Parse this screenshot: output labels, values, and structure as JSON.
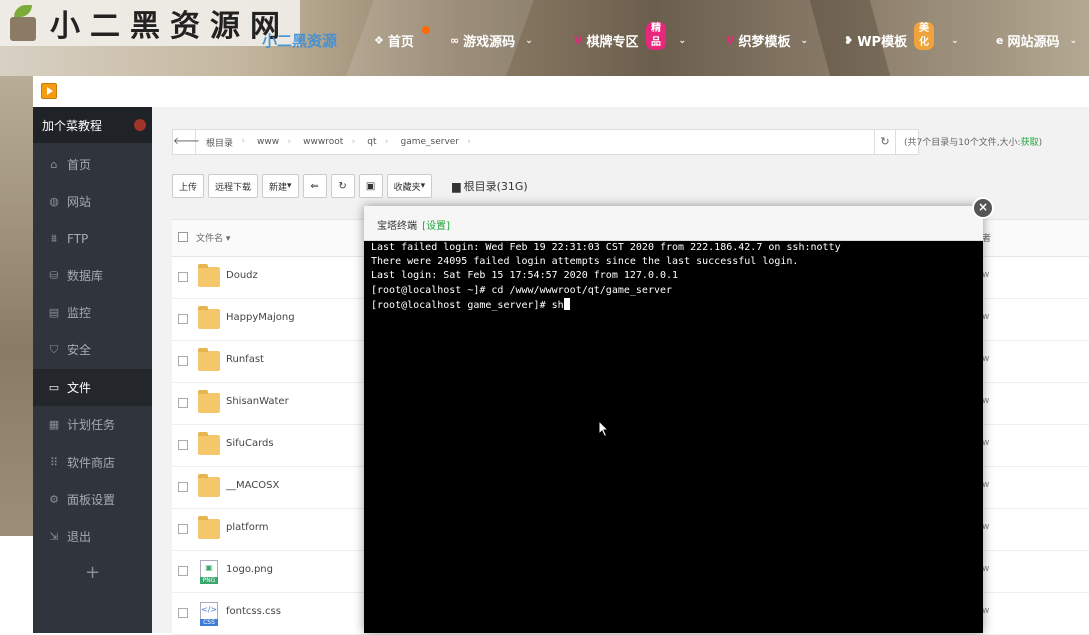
{
  "site": {
    "logo_text": "小二黑资源网",
    "brand_faded": "小二黑资源",
    "nav": [
      {
        "label": "首页",
        "icon": "❖"
      },
      {
        "label": "游戏源码",
        "icon": "∞"
      },
      {
        "label": "棋牌专区",
        "icon": "V"
      },
      {
        "label": "织梦模板",
        "icon": "V"
      },
      {
        "label": "WP模板",
        "icon": "❥"
      },
      {
        "label": "网站源码",
        "icon": "e"
      }
    ],
    "badge_jingpin": "精品",
    "badge_meihua": "美化"
  },
  "sidebar": {
    "brand": "加个菜教程",
    "items": [
      {
        "label": "首页",
        "icon": "⌂"
      },
      {
        "label": "网站",
        "icon": "◍"
      },
      {
        "label": "FTP",
        "icon": "⩩"
      },
      {
        "label": "数据库",
        "icon": "⛁"
      },
      {
        "label": "监控",
        "icon": "▤"
      },
      {
        "label": "安全",
        "icon": "⛉"
      },
      {
        "label": "文件",
        "icon": "▭"
      },
      {
        "label": "计划任务",
        "icon": "▦"
      },
      {
        "label": "软件商店",
        "icon": "⠿"
      },
      {
        "label": "面板设置",
        "icon": "⚙"
      },
      {
        "label": "退出",
        "icon": "⇲"
      }
    ],
    "add": "+"
  },
  "files": {
    "path": [
      "根目录",
      "www",
      "wwwroot",
      "qt",
      "game_server"
    ],
    "info_prefix": "(共7个目录与10个文件,大小:",
    "info_link": "获取",
    "info_suffix": ")",
    "toolbar": {
      "upload": "上传",
      "remote_download": "远程下载",
      "new": "新建",
      "favorites": "收藏夹",
      "root_dir": "根目录(31G)"
    },
    "col_name": "文件名",
    "col_owner": "者",
    "rows": [
      {
        "name": "Doudz",
        "type": "folder",
        "owner": "w"
      },
      {
        "name": "HappyMajong",
        "type": "folder",
        "owner": "w"
      },
      {
        "name": "Runfast",
        "type": "folder",
        "owner": "w"
      },
      {
        "name": "ShisanWater",
        "type": "folder",
        "owner": "w"
      },
      {
        "name": "SifuCards",
        "type": "folder",
        "owner": "w"
      },
      {
        "name": "__MACOSX",
        "type": "folder",
        "owner": "w"
      },
      {
        "name": "platform",
        "type": "folder",
        "owner": "w"
      },
      {
        "name": "1ogo.png",
        "type": "png",
        "owner": "w"
      },
      {
        "name": "fontcss.css",
        "type": "css",
        "owner": "w"
      }
    ]
  },
  "terminal": {
    "title": "宝塔终端",
    "settings": "[设置]",
    "close": "×",
    "lines": [
      "Last failed login: Wed Feb 19 22:31:03 CST 2020 from 222.186.42.7 on ssh:notty",
      "There were 24095 failed login attempts since the last successful login.",
      "Last login: Sat Feb 15 17:54:57 2020 from 127.0.0.1",
      "[root@localhost ~]# cd /www/wwwroot/qt/game_server"
    ],
    "prompt": "[root@localhost game_server]# ",
    "input": "sh"
  }
}
